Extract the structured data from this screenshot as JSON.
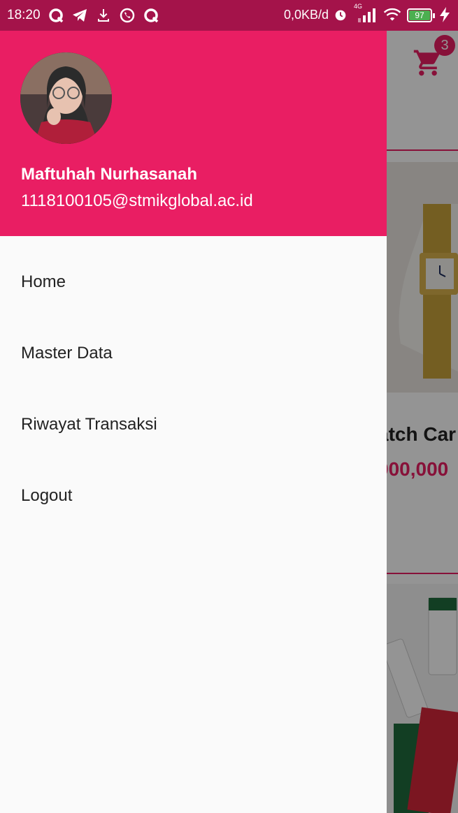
{
  "status_bar": {
    "time": "18:20",
    "net_speed": "0,0KB/d",
    "network": "4G",
    "battery": "97",
    "icons": [
      "q-app-icon",
      "telegram-icon",
      "download-icon",
      "whatsapp-icon",
      "q-app-icon",
      "alarm-icon",
      "signal-icon",
      "wifi-icon",
      "battery-icon",
      "charging-icon"
    ]
  },
  "background_app": {
    "cart_count": "3",
    "product_name_partial": "atch Car",
    "product_price_partial": "000,000"
  },
  "drawer": {
    "user_name": "Maftuhah Nurhasanah",
    "user_email": "1118100105@stmikglobal.ac.id",
    "menu": [
      {
        "label": "Home"
      },
      {
        "label": "Master Data"
      },
      {
        "label": "Riwayat Transaksi"
      },
      {
        "label": "Logout"
      }
    ]
  },
  "colors": {
    "primary": "#e91e63",
    "status_bar": "#a4134a",
    "drawer_bg": "#fafafa"
  }
}
